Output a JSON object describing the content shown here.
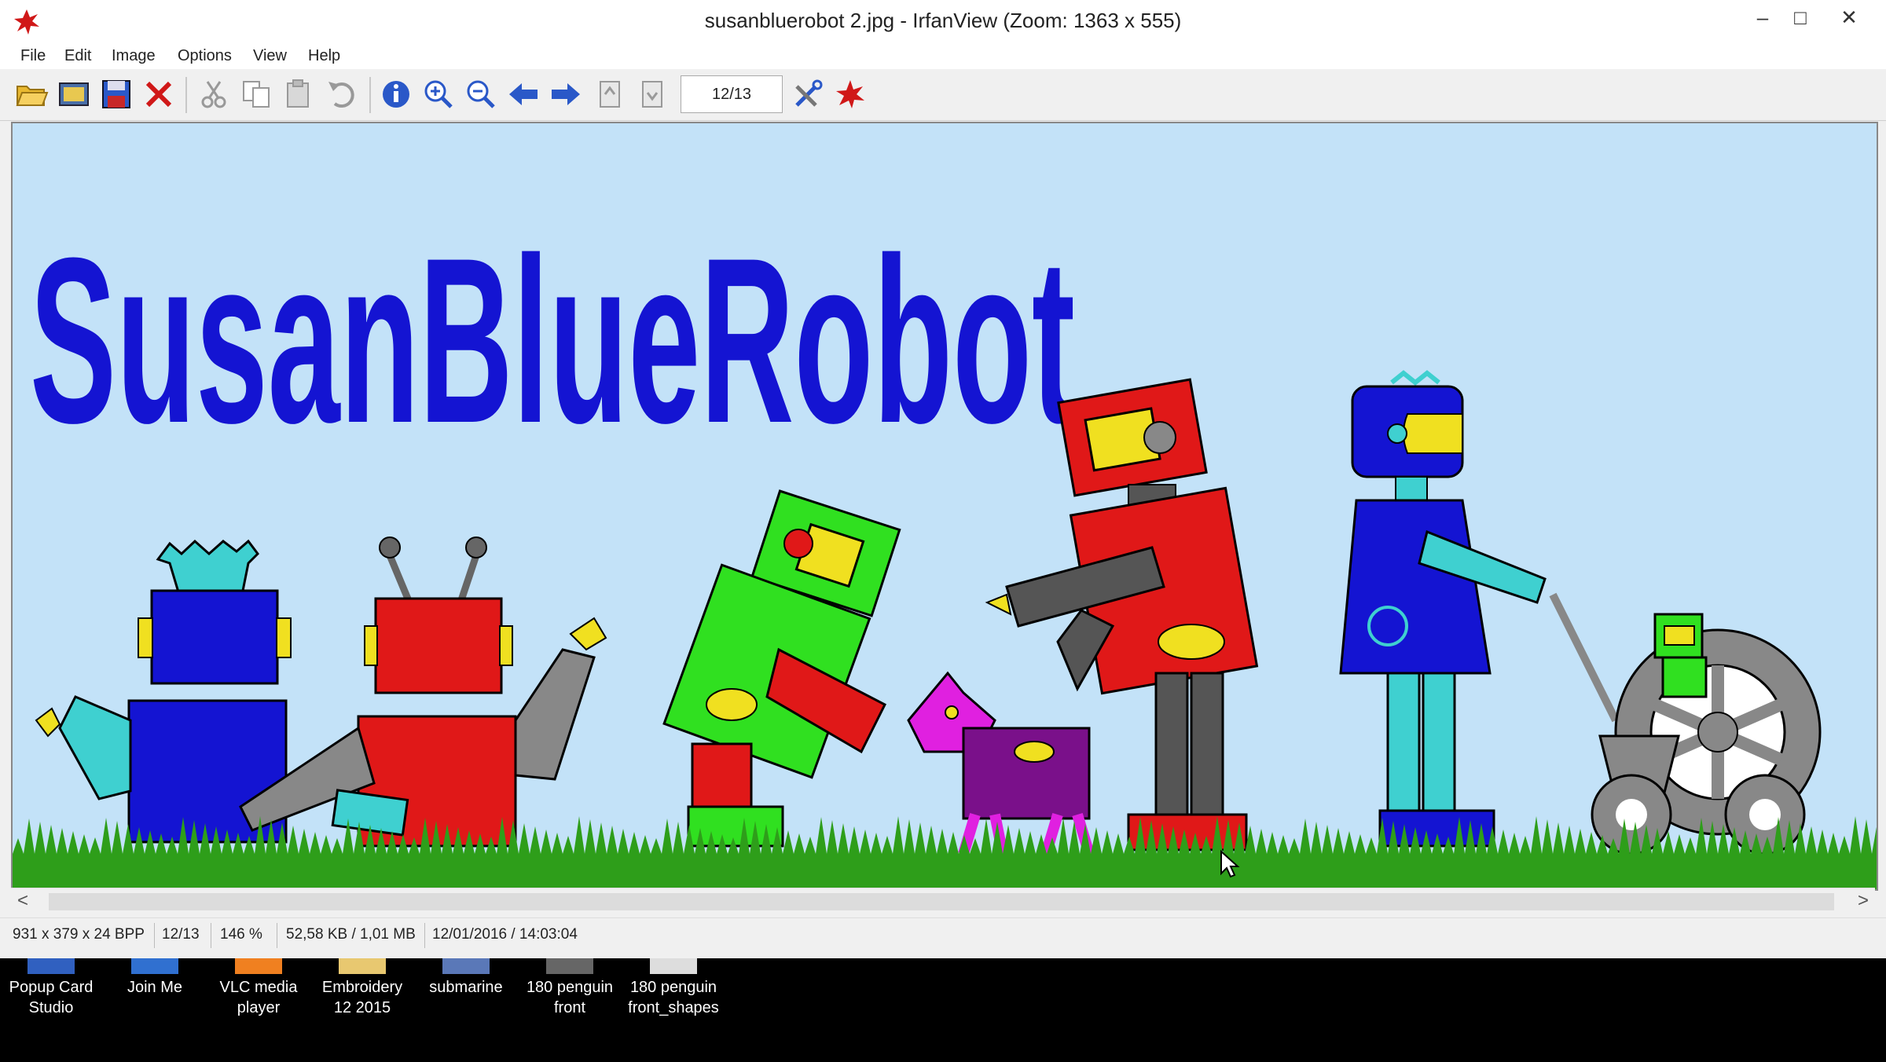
{
  "window": {
    "title": "susanbluerobot 2.jpg - IrfanView (Zoom: 1363 x 555)",
    "controls": {
      "minimize": "–",
      "maximize": "□",
      "close": "✕"
    }
  },
  "menu": {
    "file": "File",
    "edit": "Edit",
    "image": "Image",
    "options": "Options",
    "view": "View",
    "help": "Help"
  },
  "toolbar": {
    "page_indicator": "12/13",
    "icons": [
      "open-folder-icon",
      "slideshow-icon",
      "save-icon",
      "delete-icon",
      "cut-icon",
      "copy-icon",
      "paste-icon",
      "undo-icon",
      "info-icon",
      "zoom-in-icon",
      "zoom-out-icon",
      "previous-icon",
      "next-icon",
      "first-page-icon",
      "last-page-icon",
      "settings-icon",
      "irfanview-logo-icon"
    ]
  },
  "image": {
    "heading": "SusanBlueRobot",
    "colors": {
      "sky": "#c3e2f8",
      "text_blue": "#1414d2",
      "grass": "#2e9e1a"
    }
  },
  "scrollbar": {
    "left": "<",
    "right": ">"
  },
  "status": {
    "dimensions": "931 x 379 x 24 BPP",
    "page": "12/13",
    "zoom": "146 %",
    "size": "52,58 KB / 1,01 MB",
    "datetime": "12/01/2016 / 14:03:04"
  },
  "desktop": {
    "icons": [
      {
        "line1": "Popup Card",
        "line2": "Studio"
      },
      {
        "line1": "Join Me",
        "line2": ""
      },
      {
        "line1": "VLC media",
        "line2": "player"
      },
      {
        "line1": "Embroidery",
        "line2": "12 2015"
      },
      {
        "line1": "submarine",
        "line2": ""
      },
      {
        "line1": "180 penguin",
        "line2": "front"
      },
      {
        "line1": "180 penguin",
        "line2": "front_shapes"
      }
    ]
  }
}
